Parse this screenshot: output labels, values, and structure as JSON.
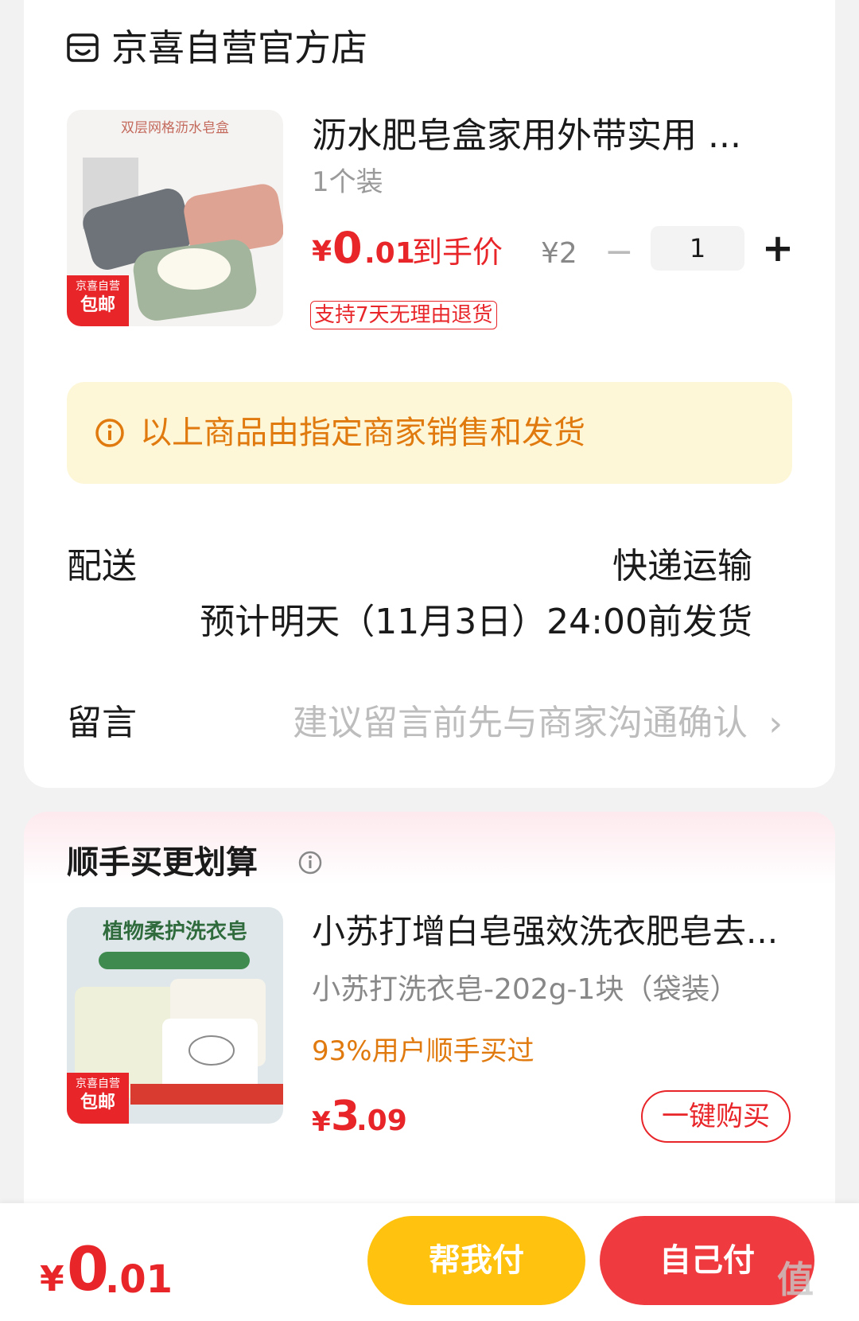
{
  "shop": {
    "name": "京喜自营官方店",
    "icon": "shop-icon"
  },
  "product1": {
    "title": "沥水肥皂盒家用外带实用 ...",
    "spec": "1个装",
    "price_symbol": "¥",
    "price_int": "0",
    "price_dec": ".01",
    "price_label": "到手价",
    "original_price": "¥2",
    "quantity": "1",
    "minus_label": "−",
    "plus_label": "+",
    "return_tag": "支持7天无理由退货",
    "thumb_title": "双层网格沥水皂盒",
    "thumb_badge_top": "京喜自营",
    "thumb_badge_bottom": "包邮"
  },
  "notice": {
    "text": "以上商品由指定商家销售和发货",
    "icon": "info-circle-icon"
  },
  "shipping": {
    "label": "配送",
    "method": "快递运输",
    "eta": "预计明天（11月3日）24:00前发货"
  },
  "message": {
    "label": "留言",
    "placeholder": "建议留言前先与商家沟通确认",
    "chevron": "›"
  },
  "recommend": {
    "title": "顺手买更划算",
    "info_icon": "info-circle-icon",
    "product": {
      "title": "小苏打增白皂强效洗衣肥皂去...",
      "spec": "小苏打洗衣皂-202g-1块（袋装）",
      "hint": "93%用户顺手买过",
      "price_symbol": "¥",
      "price_int": "3",
      "price_dec": ".09",
      "buy_label": "一键购买",
      "thumb_title": "植物柔护洗衣皂",
      "thumb_badge_top": "京喜自营",
      "thumb_badge_bottom": "包邮"
    }
  },
  "bottom": {
    "total_symbol": "¥",
    "total_int": "0",
    "total_dec": ".01",
    "help_pay": "帮我付",
    "self_pay": "自己付"
  },
  "watermark": "值",
  "colors": {
    "accent": "#e8262a",
    "notice_bg": "#fdf7d8",
    "notice_text": "#e07a0f",
    "help_btn": "#ffc20e",
    "self_btn": "#ef3b3f"
  }
}
